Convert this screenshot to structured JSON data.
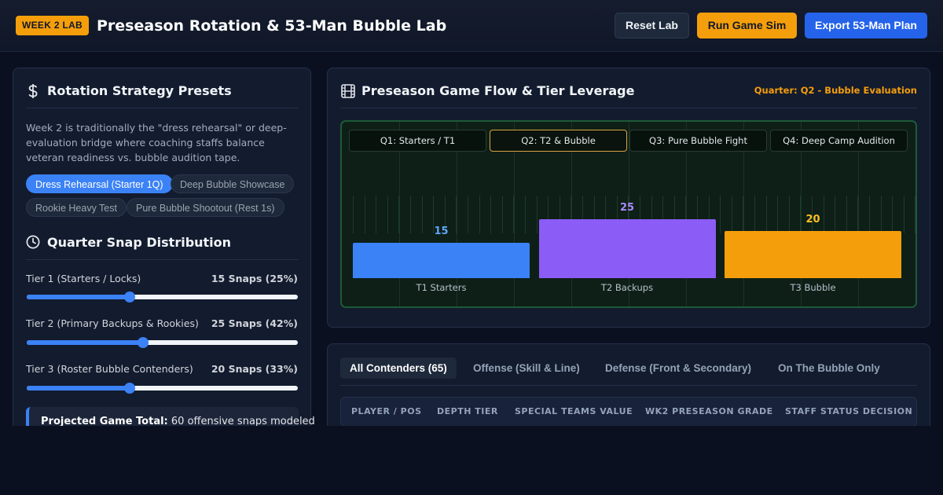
{
  "header": {
    "badge": "WEEK 2 LAB",
    "title": "Preseason Rotation & 53-Man Bubble Lab",
    "buttons": {
      "reset": "Reset Lab",
      "sim": "Run Game Sim",
      "export": "Export 53-Man Plan"
    }
  },
  "presets": {
    "title": "Rotation Strategy Presets",
    "icon": "dollar-icon",
    "description": "Week 2 is traditionally the \"dress rehearsal\" or deep-evaluation bridge where coaching staffs balance veteran readiness vs. bubble audition tape.",
    "chips": [
      {
        "label": "Dress Rehearsal (Starter 1Q)",
        "active": true
      },
      {
        "label": "Deep Bubble Showcase",
        "active": false
      },
      {
        "label": "Rookie Heavy Test",
        "active": false
      },
      {
        "label": "Pure Bubble Shootout (Rest 1s)",
        "active": false
      }
    ]
  },
  "distribution": {
    "title": "Quarter Snap Distribution",
    "icon": "clock-icon",
    "tiers": [
      {
        "label": "Tier 1 (Starters / Locks)",
        "value": "15 Snaps (25%)",
        "level": 0.38
      },
      {
        "label": "Tier 2 (Primary Backups & Rookies)",
        "value": "25 Snaps (42%)",
        "level": 0.43
      },
      {
        "label": "Tier 3 (Roster Bubble Contenders)",
        "value": "20 Snaps (33%)",
        "level": 0.38
      }
    ],
    "total_label": "Projected Game Total:",
    "total_value": "60 offensive snaps modeled"
  },
  "flow": {
    "title": "Preseason Game Flow & Tier Leverage",
    "icon": "film-icon",
    "quarter_note": "Quarter: Q2 - Bubble Evaluation",
    "quarters": [
      {
        "label": "Q1: Starters / T1",
        "active": false
      },
      {
        "label": "Q2: T2 & Bubble",
        "active": true
      },
      {
        "label": "Q3: Pure Bubble Fight",
        "active": false
      },
      {
        "label": "Q4: Deep Camp Audition",
        "active": false
      }
    ]
  },
  "chart_data": {
    "type": "bar",
    "categories": [
      "T1 Starters",
      "T2 Backups",
      "T3 Bubble"
    ],
    "values": [
      15,
      25,
      20
    ],
    "colors": [
      "#3b82f6",
      "#8b5cf6",
      "#f59e0b"
    ],
    "label_colors": [
      "#60a5fa",
      "#a78bfa",
      "#fbbf24"
    ],
    "ylim": [
      0,
      25
    ]
  },
  "table": {
    "tabs": [
      {
        "label": "All Contenders (65)",
        "active": true
      },
      {
        "label": "Offense (Skill & Line)",
        "active": false
      },
      {
        "label": "Defense (Front & Secondary)",
        "active": false
      },
      {
        "label": "On The Bubble Only",
        "active": false
      }
    ],
    "columns": [
      "PLAYER / POS",
      "DEPTH TIER",
      "SPECIAL TEAMS VALUE",
      "WK2 PRESEASON GRADE",
      "STAFF STATUS DECISION"
    ]
  }
}
